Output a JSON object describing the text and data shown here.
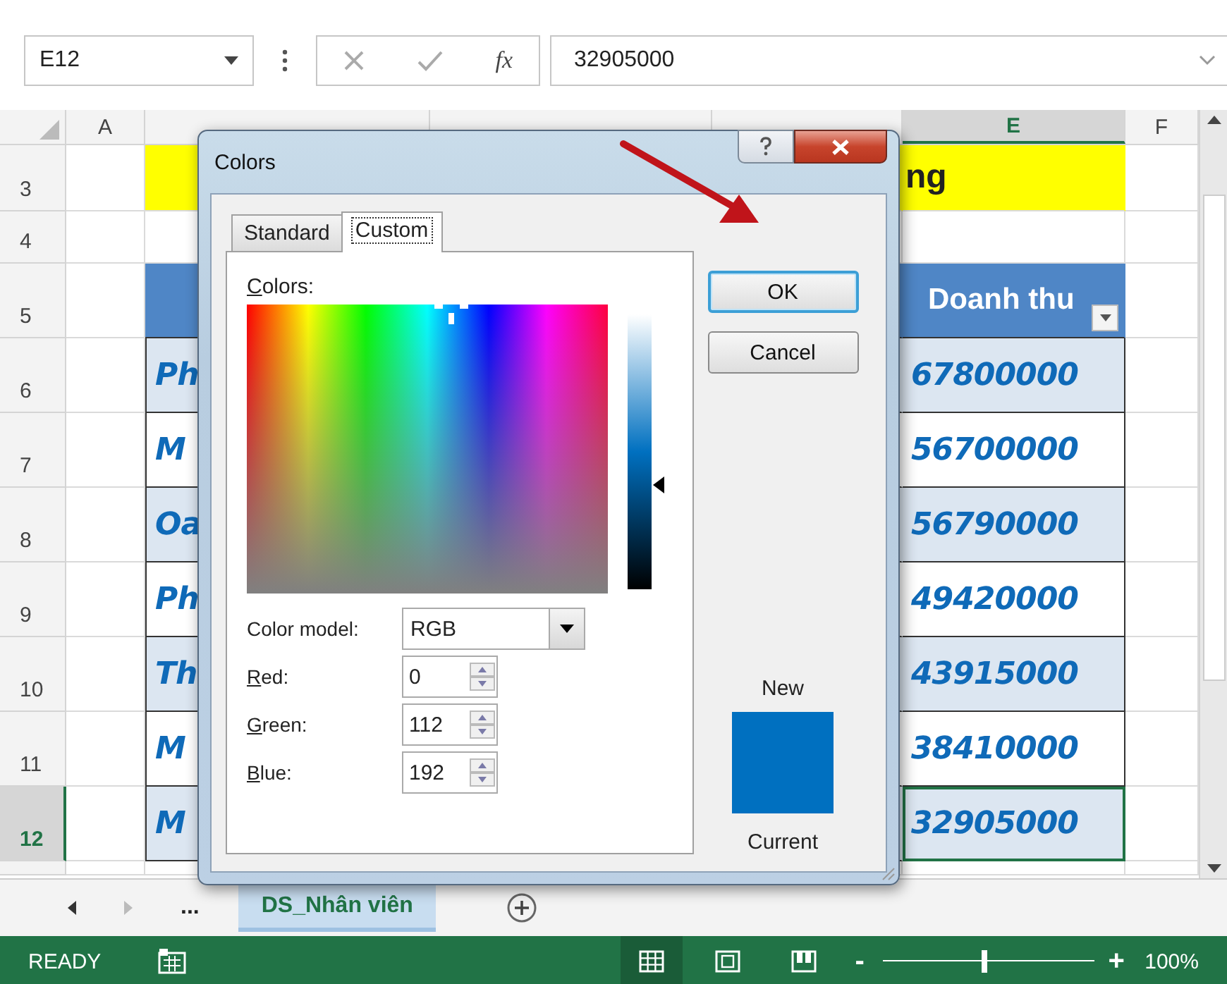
{
  "formula_bar": {
    "name_box": "E12",
    "function_label": "fx",
    "formula": "32905000"
  },
  "columns": [
    {
      "label": "A",
      "selected": false
    },
    {
      "selected": false
    },
    {
      "selected": false
    },
    {
      "selected": false
    },
    {
      "label": "E",
      "selected": true
    },
    {
      "label": "F",
      "selected": false
    }
  ],
  "rows": [
    {
      "number": "3",
      "kind": "title",
      "selected": false,
      "text": "ng"
    },
    {
      "number": "4",
      "kind": "blank",
      "selected": false
    },
    {
      "number": "5",
      "kind": "header",
      "selected": false,
      "text": "Doanh thu"
    },
    {
      "number": "6",
      "kind": "data",
      "selected": false,
      "shaded": true,
      "name": "Ph",
      "value": "67800000"
    },
    {
      "number": "7",
      "kind": "data",
      "selected": false,
      "shaded": false,
      "name": "M",
      "value": "56700000"
    },
    {
      "number": "8",
      "kind": "data",
      "selected": false,
      "shaded": true,
      "name": "Oa",
      "value": "56790000"
    },
    {
      "number": "9",
      "kind": "data",
      "selected": false,
      "shaded": false,
      "name": "Ph",
      "value": "49420000"
    },
    {
      "number": "10",
      "kind": "data",
      "selected": false,
      "shaded": true,
      "name": "Th",
      "value": "43915000"
    },
    {
      "number": "11",
      "kind": "data",
      "selected": false,
      "shaded": false,
      "name": "M",
      "value": "38410000"
    },
    {
      "number": "12",
      "kind": "data",
      "selected": true,
      "shaded": true,
      "name": "M",
      "value": "32905000"
    }
  ],
  "sheet_tabs": {
    "more": "...",
    "tabs": [
      {
        "label": "DS_Nhân viên",
        "selected": true
      }
    ]
  },
  "status_bar": {
    "mode": "READY",
    "views": [
      {
        "kind": "normal",
        "selected": true
      },
      {
        "kind": "layout",
        "selected": false
      },
      {
        "kind": "break",
        "selected": false
      }
    ],
    "zoom_out": "-",
    "zoom_in": "+",
    "zoom": {
      "level": 0.48
    },
    "zoom_label": "100%"
  },
  "dialog": {
    "title": "Colors",
    "tabs": [
      {
        "label": "Standard",
        "selected": false
      },
      {
        "label": "Custom",
        "selected": true
      }
    ],
    "colors_label": "Colors:",
    "luminance": {
      "level": 0.38
    },
    "color_model_label": "Color model:",
    "color_model": "RGB",
    "channels": [
      {
        "label": "Red:",
        "value": "0"
      },
      {
        "label": "Green:",
        "value": "112"
      },
      {
        "label": "Blue:",
        "value": "192"
      }
    ],
    "new_label": "New",
    "current_label": "Current",
    "color": "#0070c0",
    "buttons": [
      {
        "label": "OK",
        "kind": "default"
      },
      {
        "label": "Cancel",
        "kind": "normal"
      }
    ]
  }
}
